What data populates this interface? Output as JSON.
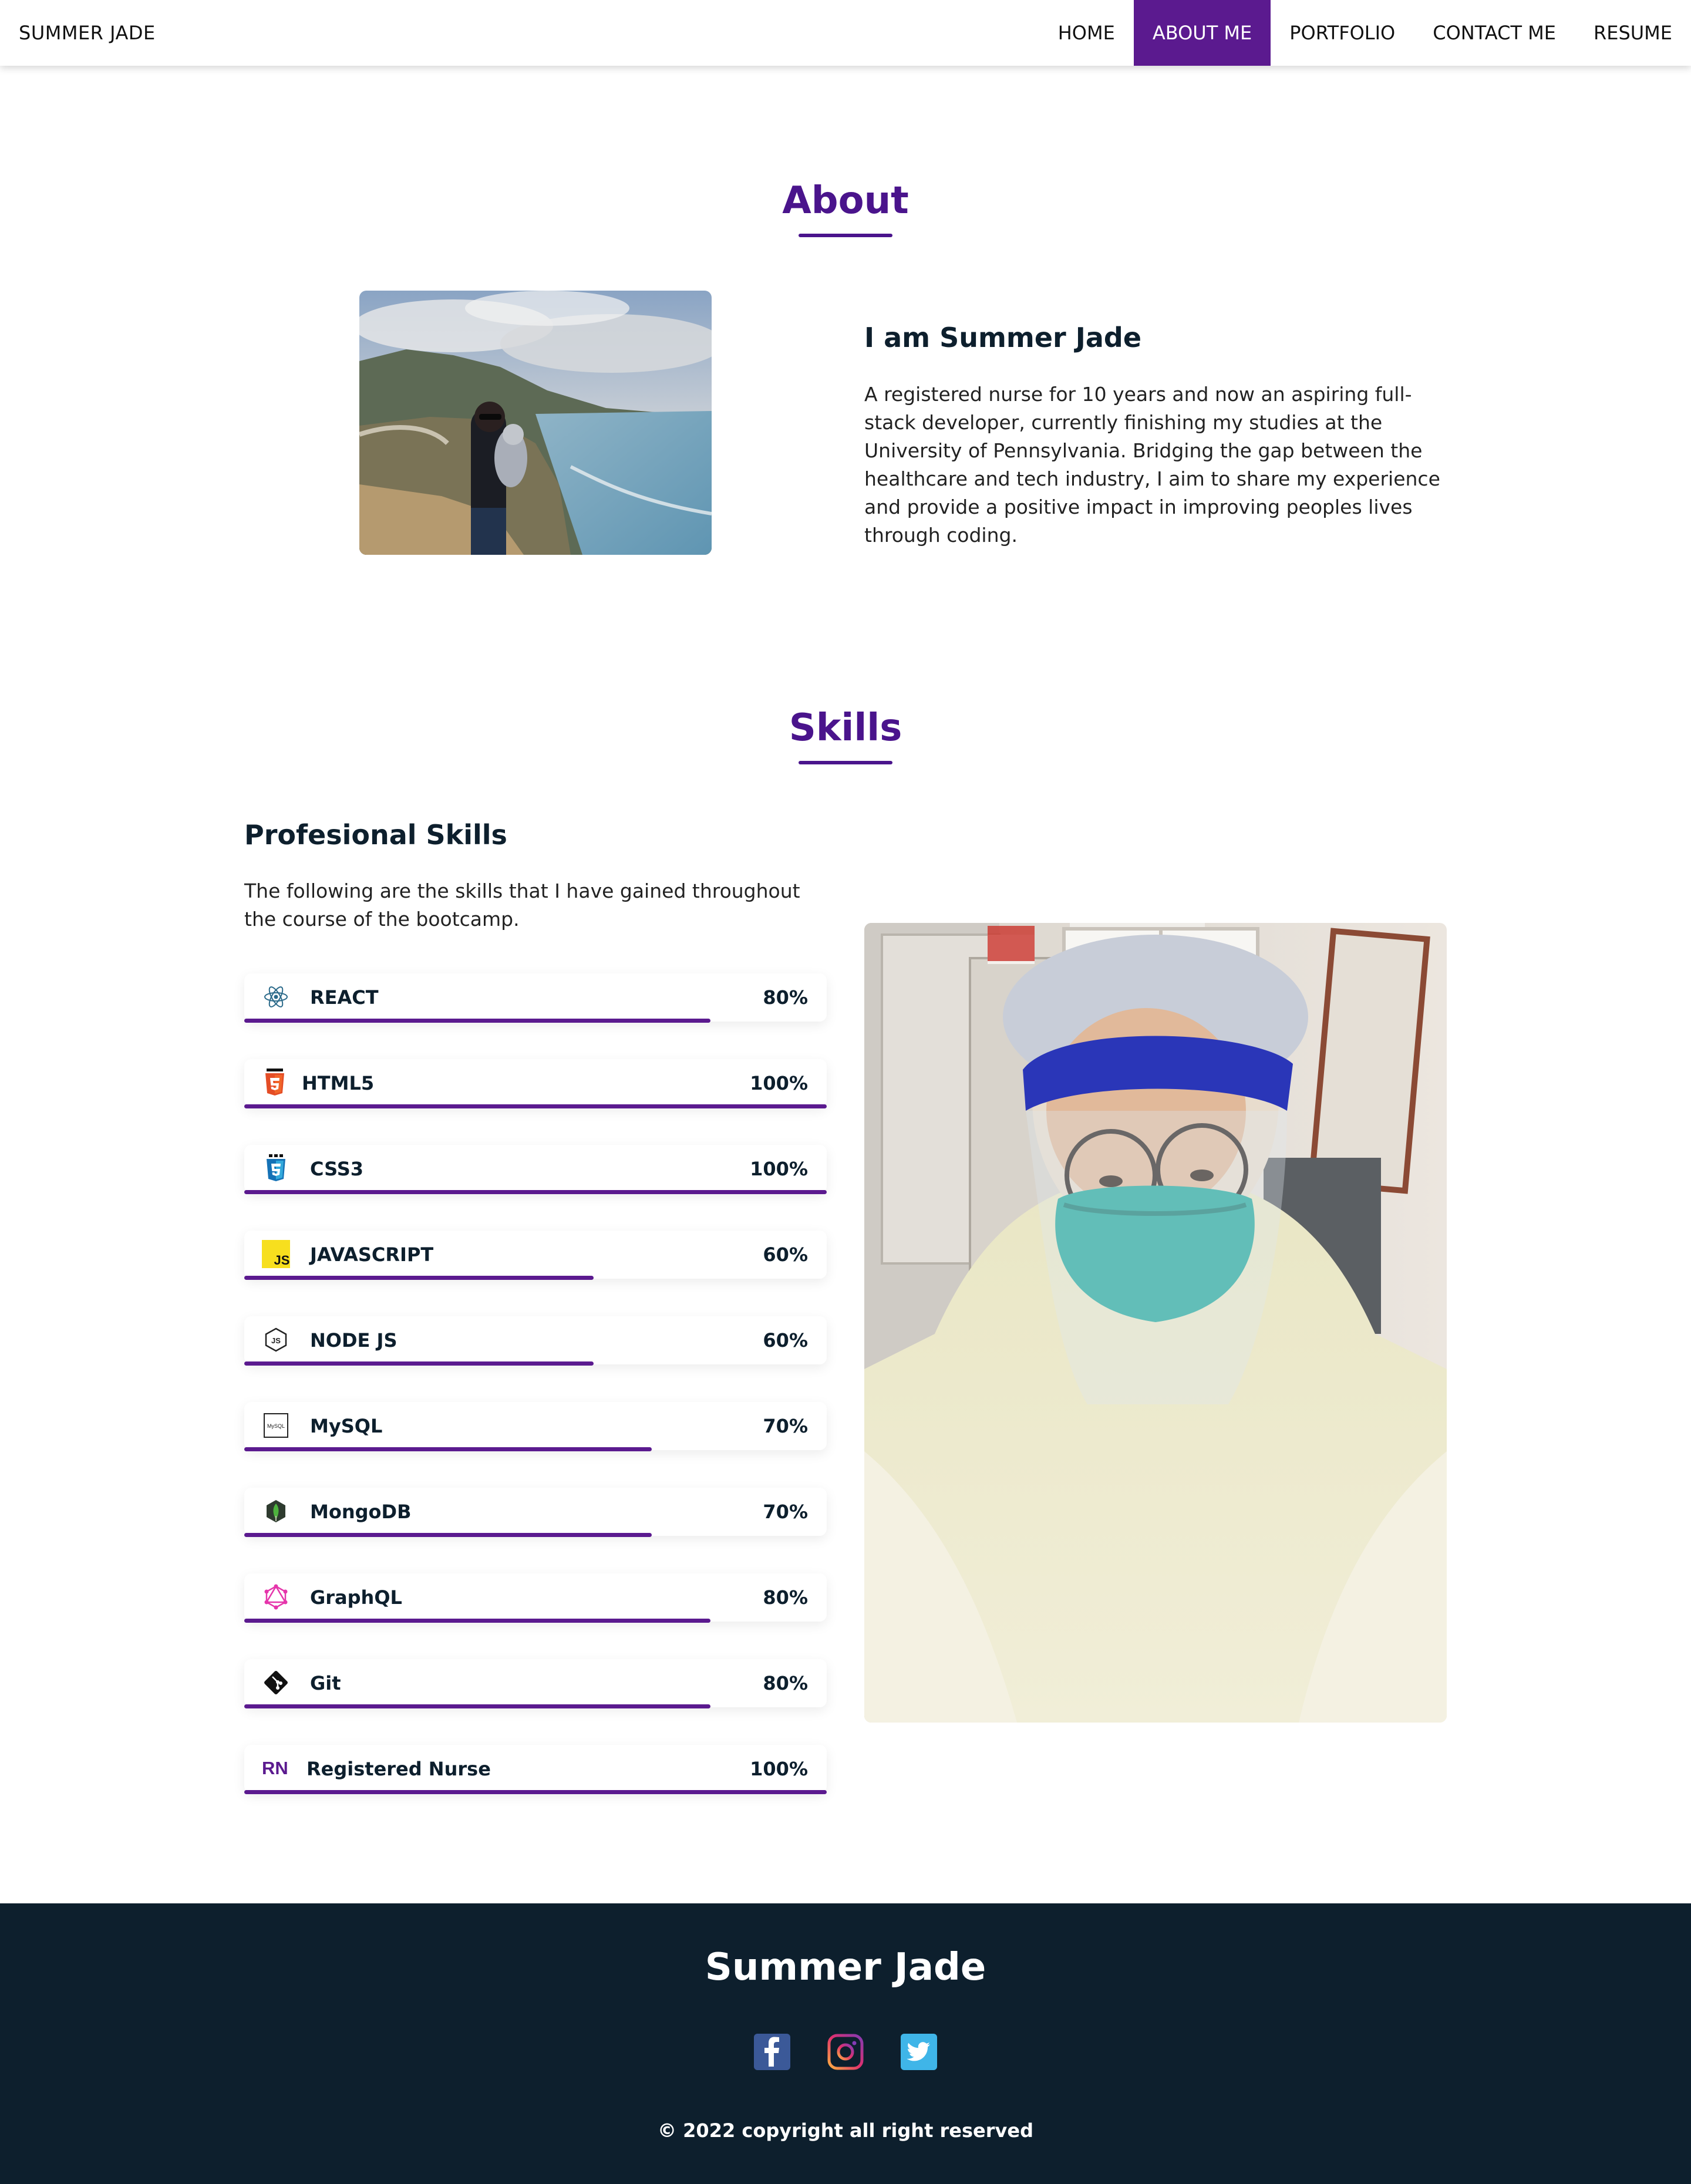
{
  "nav": {
    "brand": "SUMMER JADE",
    "links": [
      {
        "label": "HOME"
      },
      {
        "label": "ABOUT ME"
      },
      {
        "label": "PORTFOLIO"
      },
      {
        "label": "CONTACT ME"
      },
      {
        "label": "RESUME"
      }
    ],
    "active": "ABOUT ME"
  },
  "about": {
    "title": "About",
    "heading": "I am Summer Jade",
    "text": "A registered nurse for 10 years and now an aspiring full-stack developer, currently finishing my studies at the University of Pennsylvania. Bridging the gap between the healthcare and tech industry, I aim to share my experience and provide a positive impact in improving peoples lives through coding."
  },
  "skills": {
    "title": "Skills",
    "heading": "Profesional Skills",
    "text": "The following are the skills that I have gained throughout the course of the bootcamp.",
    "items": [
      {
        "name": "REACT",
        "percent": "80%",
        "level": 80,
        "icon": "react-icon"
      },
      {
        "name": "HTML5",
        "percent": "100%",
        "level": 100,
        "icon": "html5-icon"
      },
      {
        "name": "CSS3",
        "percent": "100%",
        "level": 100,
        "icon": "css3-icon"
      },
      {
        "name": "JAVASCRIPT",
        "percent": "60%",
        "level": 60,
        "icon": "javascript-icon",
        "icon_text": "JS"
      },
      {
        "name": "NODE JS",
        "percent": "60%",
        "level": 60,
        "icon": "nodejs-icon",
        "icon_text": "JS"
      },
      {
        "name": "MySQL",
        "percent": "70%",
        "level": 70,
        "icon": "mysql-icon",
        "icon_text": "MySQL"
      },
      {
        "name": "MongoDB",
        "percent": "70%",
        "level": 70,
        "icon": "mongodb-icon"
      },
      {
        "name": "GraphQL",
        "percent": "80%",
        "level": 80,
        "icon": "graphql-icon"
      },
      {
        "name": "Git",
        "percent": "80%",
        "level": 80,
        "icon": "git-icon"
      },
      {
        "name": "Registered Nurse",
        "percent": "100%",
        "level": 100,
        "icon": "rn-icon",
        "icon_text": "RN"
      }
    ]
  },
  "footer": {
    "name": "Summer Jade",
    "social": [
      "facebook-icon",
      "instagram-icon",
      "twitter-icon"
    ],
    "copyright": "© 2022 copyright all right reserved"
  },
  "colors": {
    "accent": "#5b1a8f",
    "footer_bg": "#0d1f2d"
  }
}
